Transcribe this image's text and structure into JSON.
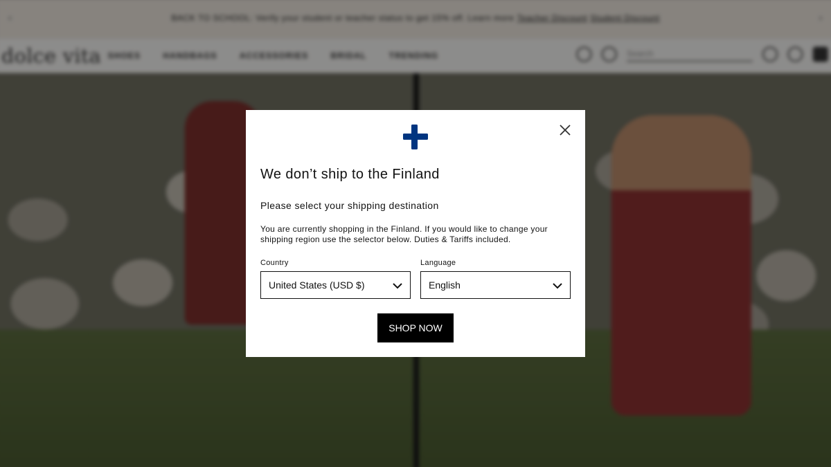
{
  "background": {
    "announcement": {
      "text": "BACK TO SCHOOL: Verify your student or teacher status to get 15% off. Learn more",
      "links": [
        "Teacher Discount",
        "Student Discount"
      ]
    },
    "nav": {
      "logo": "dolce vita",
      "items": [
        "SHOES",
        "HANDBAGS",
        "ACCESSORIES",
        "BRIDAL",
        "TRENDING"
      ],
      "search_placeholder": "Search"
    }
  },
  "modal": {
    "flag_icon": "finland-flag-icon",
    "close_icon": "close-icon",
    "title": "We don’t ship to the Finland",
    "subtitle": "Please select your shipping destination",
    "description": "You are currently shopping in the Finland. If you would like to change your shipping region use the selector below. Duties & Tariffs included.",
    "country": {
      "label": "Country",
      "value": "United States (USD $)"
    },
    "language": {
      "label": "Language",
      "value": "English"
    },
    "cta_label": "SHOP NOW"
  },
  "colors": {
    "flag_blue": "#003580",
    "overlay": "rgba(0,0,0,0.42)",
    "button_bg": "#000000",
    "button_text": "#ffffff"
  }
}
